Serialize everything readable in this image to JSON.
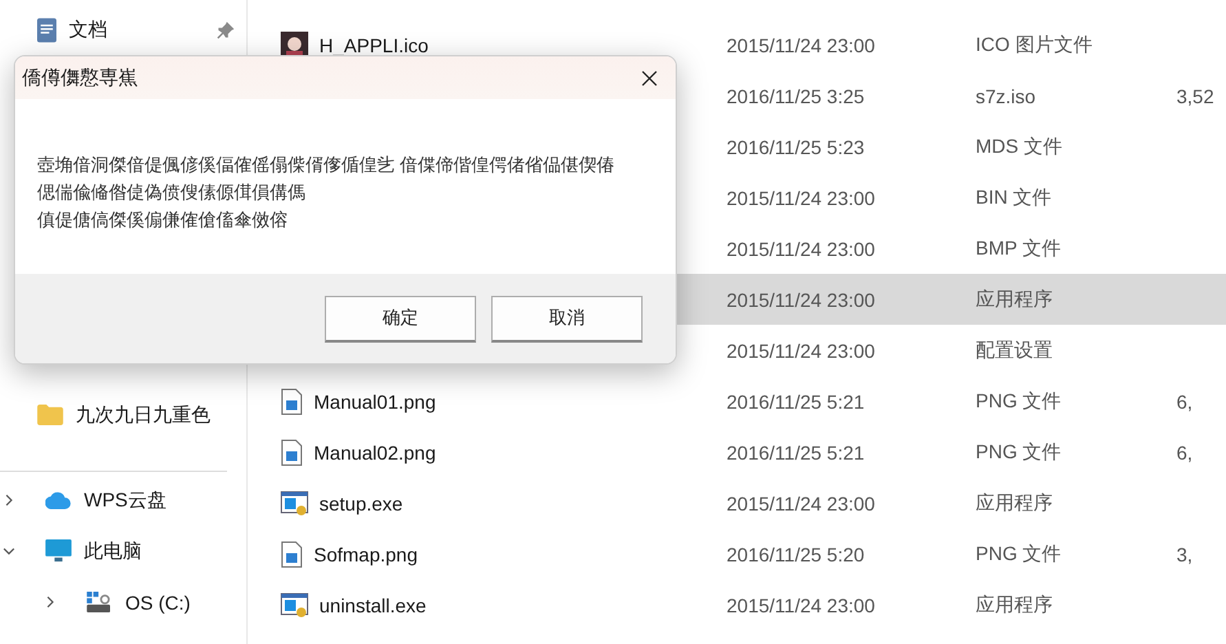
{
  "sidebar": {
    "top_items": [
      {
        "label": "文档",
        "kind": "document",
        "pinned": true
      }
    ],
    "folders": [
      {
        "label": "九次九日九重色",
        "kind": "folder"
      }
    ],
    "locations": [
      {
        "label": "WPS云盘",
        "kind": "cloud",
        "expanded": false
      },
      {
        "label": "此电脑",
        "kind": "monitor",
        "expanded": true,
        "children": [
          {
            "label": "OS (C:)",
            "kind": "drive",
            "expanded": false
          }
        ]
      }
    ]
  },
  "files": [
    {
      "name": "H_APPLI.ico",
      "kind": "ico",
      "date": "2015/11/24 23:00",
      "type": "ICO 图片文件",
      "selected": false
    },
    {
      "date": "2016/11/25 3:25",
      "type": "s7z.iso",
      "size": "3,52",
      "selected": false
    },
    {
      "date": "2016/11/25 5:23",
      "type": "MDS 文件",
      "selected": false
    },
    {
      "date": "2015/11/24 23:00",
      "type": "BIN 文件",
      "selected": false
    },
    {
      "date": "2015/11/24 23:00",
      "type": "BMP 文件",
      "selected": false
    },
    {
      "date": "2015/11/24 23:00",
      "type": "应用程序",
      "selected": true
    },
    {
      "date": "2015/11/24 23:00",
      "type": "配置设置",
      "selected": false
    },
    {
      "name": "Manual01.png",
      "kind": "png",
      "date": "2016/11/25 5:21",
      "type": "PNG 文件",
      "size": "6,",
      "selected": false
    },
    {
      "name": "Manual02.png",
      "kind": "png",
      "date": "2016/11/25 5:21",
      "type": "PNG 文件",
      "size": "6,",
      "selected": false
    },
    {
      "name": "setup.exe",
      "kind": "exe",
      "date": "2015/11/24 23:00",
      "type": "应用程序",
      "selected": false
    },
    {
      "name": "Sofmap.png",
      "kind": "png",
      "date": "2016/11/25 5:20",
      "type": "PNG 文件",
      "size": "3,",
      "selected": false
    },
    {
      "name": "uninstall.exe",
      "kind": "exe",
      "date": "2015/11/24 23:00",
      "type": "应用程序",
      "selected": false
    }
  ],
  "dialog": {
    "title": "僑僔儛懯専嶣",
    "message": [
      " 壺埆偣洞傑偣偍偑偐傒偪傕傜傝偨偦偧偱偟乧 偣偞偙偕偟偔偖偗偘偡偰偆",
      "偲偳偸偹偺偼偽偾傁傃傆傇傊傋傌",
      "傎偍傏傐傑傒傓傔傕傖傗傘傚傛"
    ],
    "buttons": [
      "确定",
      "取消"
    ]
  }
}
